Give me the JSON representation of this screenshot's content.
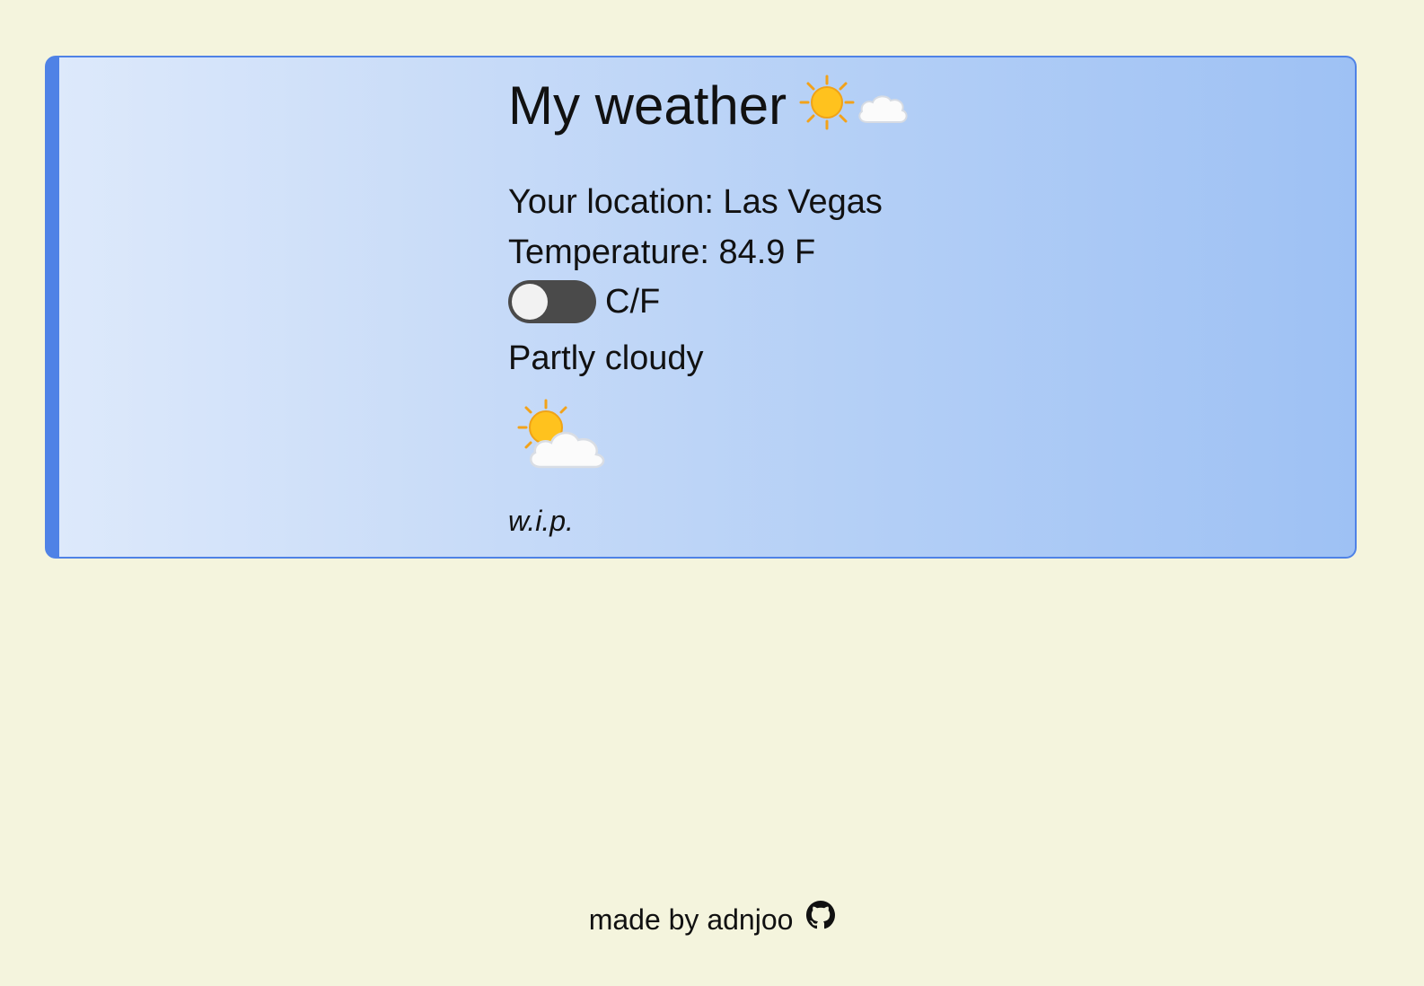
{
  "header": {
    "title": "My weather",
    "title_icons": [
      "sun-icon",
      "cloud-icon"
    ]
  },
  "weather": {
    "location_text": "Your location: Las Vegas",
    "temperature_text": "Temperature: 84.9 F",
    "unit_toggle": {
      "label": "C/F",
      "state": "off"
    },
    "condition_text": "Partly cloudy",
    "condition_icon": "partly-cloudy-icon",
    "note": "w.i.p."
  },
  "footer": {
    "text": "made by adnjoo",
    "icon": "github-icon"
  },
  "colors": {
    "page_background": "#f4f4dd",
    "card_accent": "#4f82e6",
    "gradient_start": "#dde9fb",
    "gradient_end": "#9ec1f4",
    "toggle_track": "#4a4a4a"
  }
}
